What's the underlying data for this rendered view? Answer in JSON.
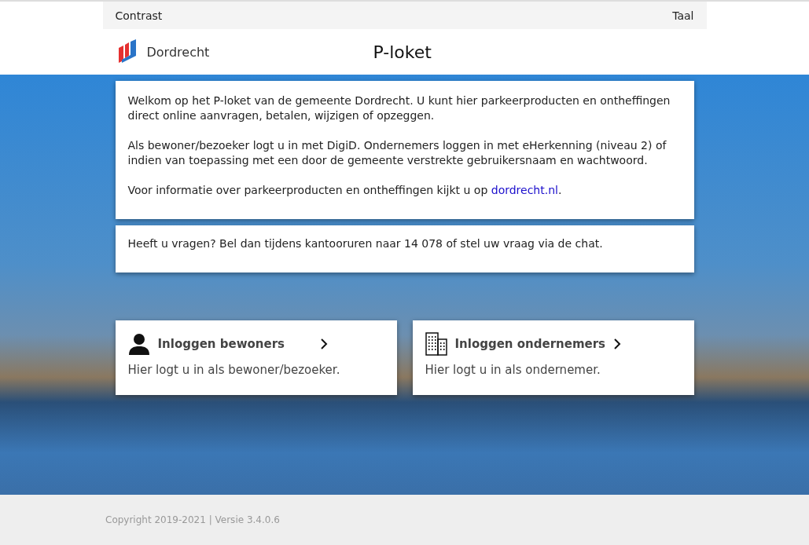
{
  "top_bar": {
    "left": "Contrast",
    "right": "Taal"
  },
  "header": {
    "brand": "Dordrecht",
    "title": "P-loket"
  },
  "intro": {
    "paragraphs": [
      {
        "text": "Welkom op het P-loket van de gemeente Dordrecht. U kunt hier parkeerproducten en ontheffingen direct online aanvragen, betalen, wijzigen of opzeggen."
      },
      {
        "text": "Als bewoner/bezoeker logt u in met DigiD. Ondernemers loggen in met eHerkenning (niveau 2) of indien van toepassing met een door de gemeente verstrekte gebruikersnaam en wachtwoord."
      },
      {
        "text": "Voor informatie over parkeerproducten en ontheffingen kijkt u op ",
        "link": "dordrecht.nl",
        "after": "."
      }
    ]
  },
  "contact": "Heeft u vragen? Bel dan tijdens kantooruren naar 14 078 of stel uw vraag via de chat.",
  "logins": [
    {
      "kind": "person",
      "title": "Inloggen bewoners",
      "description": "Hier logt u in als bewoner/bezoeker."
    },
    {
      "kind": "building",
      "title": "Inloggen ondernemers",
      "description": "Hier logt u in als ondernemer."
    }
  ],
  "footer": "Copyright 2019-2021 | Versie 3.4.0.6"
}
